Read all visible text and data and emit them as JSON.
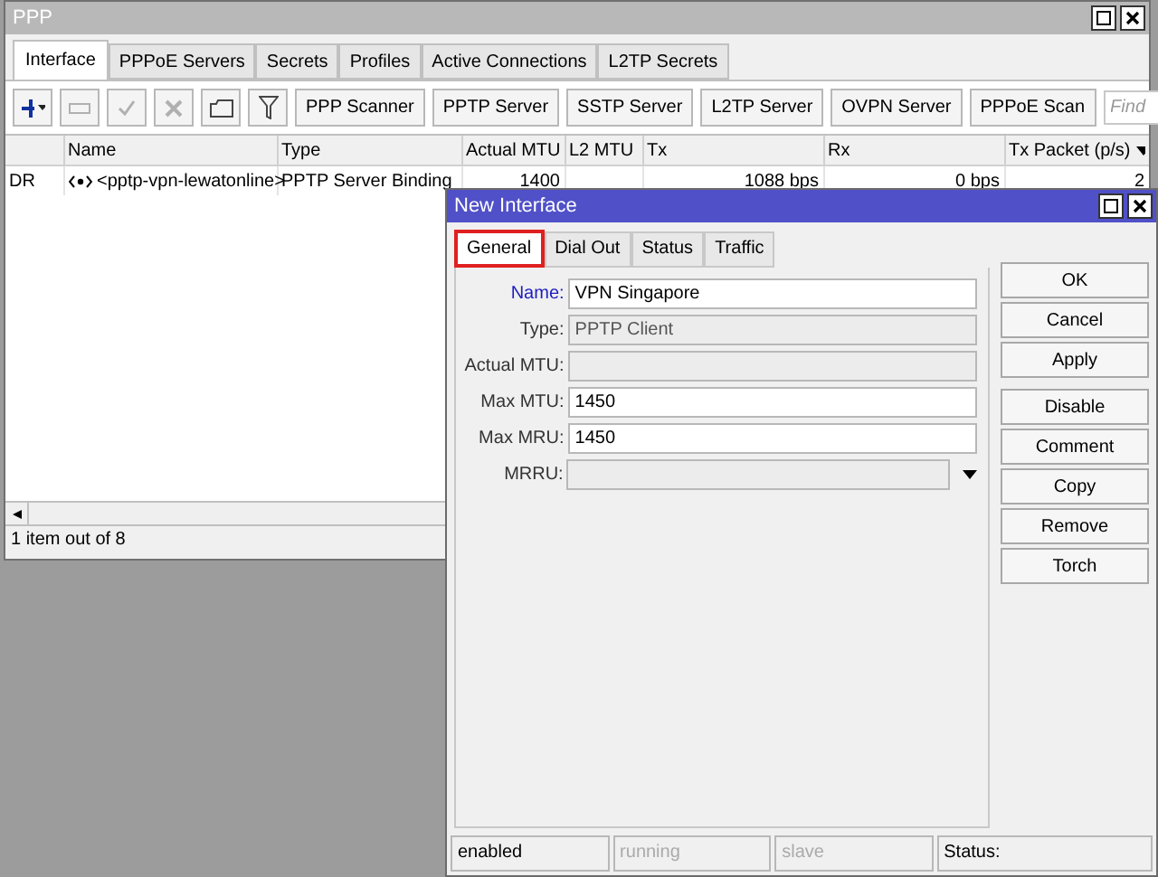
{
  "window": {
    "title": "PPP"
  },
  "tabs": [
    {
      "label": "Interface",
      "selected": true
    },
    {
      "label": "PPPoE Servers",
      "selected": false
    },
    {
      "label": "Secrets",
      "selected": false
    },
    {
      "label": "Profiles",
      "selected": false
    },
    {
      "label": "Active Connections",
      "selected": false
    },
    {
      "label": "L2TP Secrets",
      "selected": false
    }
  ],
  "toolbar": {
    "icon_buttons": [
      {
        "kind": "add",
        "disabled": false
      },
      {
        "kind": "remove",
        "disabled": true
      },
      {
        "kind": "enable",
        "disabled": true
      },
      {
        "kind": "disable",
        "disabled": true
      },
      {
        "kind": "comment",
        "disabled": false
      },
      {
        "kind": "filter",
        "disabled": false
      }
    ],
    "buttons": [
      "PPP Scanner",
      "PPTP Server",
      "SSTP Server",
      "L2TP Server",
      "OVPN Server",
      "PPPoE Scan"
    ],
    "find": {
      "placeholder": "Find"
    }
  },
  "table": {
    "columns": [
      "",
      "Name",
      "Type",
      "Actual MTU",
      "L2 MTU",
      "Tx",
      "Rx",
      "Tx Packet (p/s)"
    ],
    "rows": [
      {
        "cells": [
          "DR",
          "<pptp-vpn-lewatonline>",
          "PPTP Server Binding",
          "1400",
          "",
          "1088 bps",
          "0 bps",
          "2"
        ]
      }
    ]
  },
  "status_bar": "1 item out of 8",
  "dialog": {
    "title": "New Interface",
    "tabs": [
      {
        "label": "General",
        "selected": true
      },
      {
        "label": "Dial Out",
        "selected": false
      },
      {
        "label": "Status",
        "selected": false
      },
      {
        "label": "Traffic",
        "selected": false
      }
    ],
    "fields": [
      {
        "label": "Name:",
        "value": "VPN Singapore",
        "kind": "text",
        "disabled": false,
        "highlighted": true
      },
      {
        "label": "Type:",
        "value": "PPTP Client",
        "kind": "text",
        "disabled": true,
        "highlighted": false
      },
      {
        "label": "Actual MTU:",
        "kind": "text",
        "disabled": true,
        "highlighted": false
      },
      {
        "label": "Max MTU:",
        "value": "1450",
        "kind": "text",
        "disabled": false,
        "highlighted": false
      },
      {
        "label": "Max MRU:",
        "value": "1450",
        "kind": "text",
        "disabled": false,
        "highlighted": false
      },
      {
        "label": "MRRU:",
        "kind": "dropdown",
        "disabled": true,
        "highlighted": false
      }
    ],
    "buttons": [
      "OK",
      "Cancel",
      "Apply",
      "Disable",
      "Comment",
      "Copy",
      "Remove",
      "Torch"
    ],
    "status": [
      {
        "text": "enabled",
        "disabled": false
      },
      {
        "text": "running",
        "disabled": true
      },
      {
        "text": "slave",
        "disabled": true
      },
      {
        "text": "Status:",
        "disabled": false
      }
    ]
  }
}
